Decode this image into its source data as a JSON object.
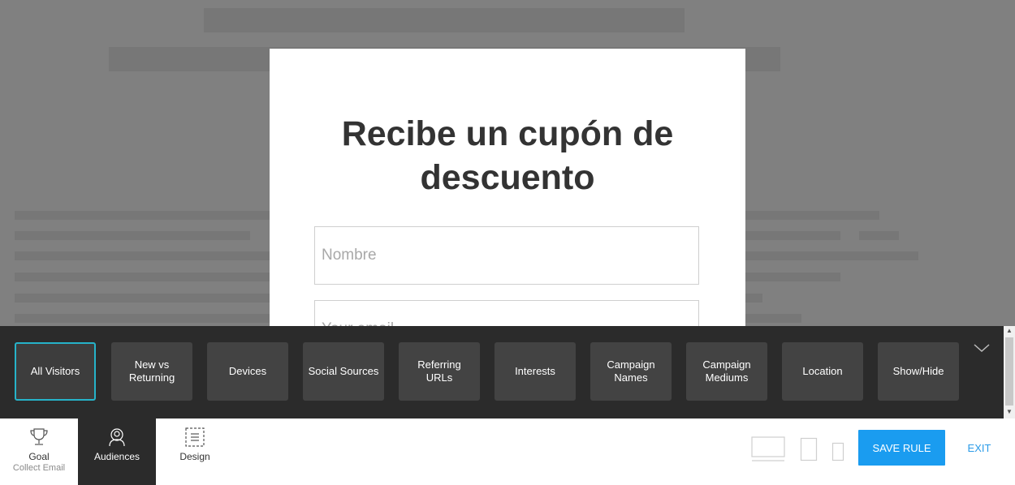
{
  "popup": {
    "heading": "Recibe un cupón de descuento",
    "fields": [
      {
        "placeholder": "Nombre"
      },
      {
        "placeholder": "Your email"
      }
    ]
  },
  "audiences": [
    {
      "label": "All Visitors",
      "active": true
    },
    {
      "label": "New vs\nReturning"
    },
    {
      "label": "Devices"
    },
    {
      "label": "Social Sources"
    },
    {
      "label": "Referring\nURLs"
    },
    {
      "label": "Interests"
    },
    {
      "label": "Campaign\nNames"
    },
    {
      "label": "Campaign\nMediums"
    },
    {
      "label": "Location"
    },
    {
      "label": "Show/Hide"
    }
  ],
  "tabs": {
    "goal": {
      "label": "Goal",
      "sub": "Collect Email"
    },
    "audiences": {
      "label": "Audiences"
    },
    "design": {
      "label": "Design"
    }
  },
  "actions": {
    "save": "SAVE RULE",
    "exit": "EXIT"
  },
  "colors": {
    "accent": "#1a9cf0",
    "active_outline": "#26b3c9",
    "toolbar_bg": "#2b2b2b"
  }
}
